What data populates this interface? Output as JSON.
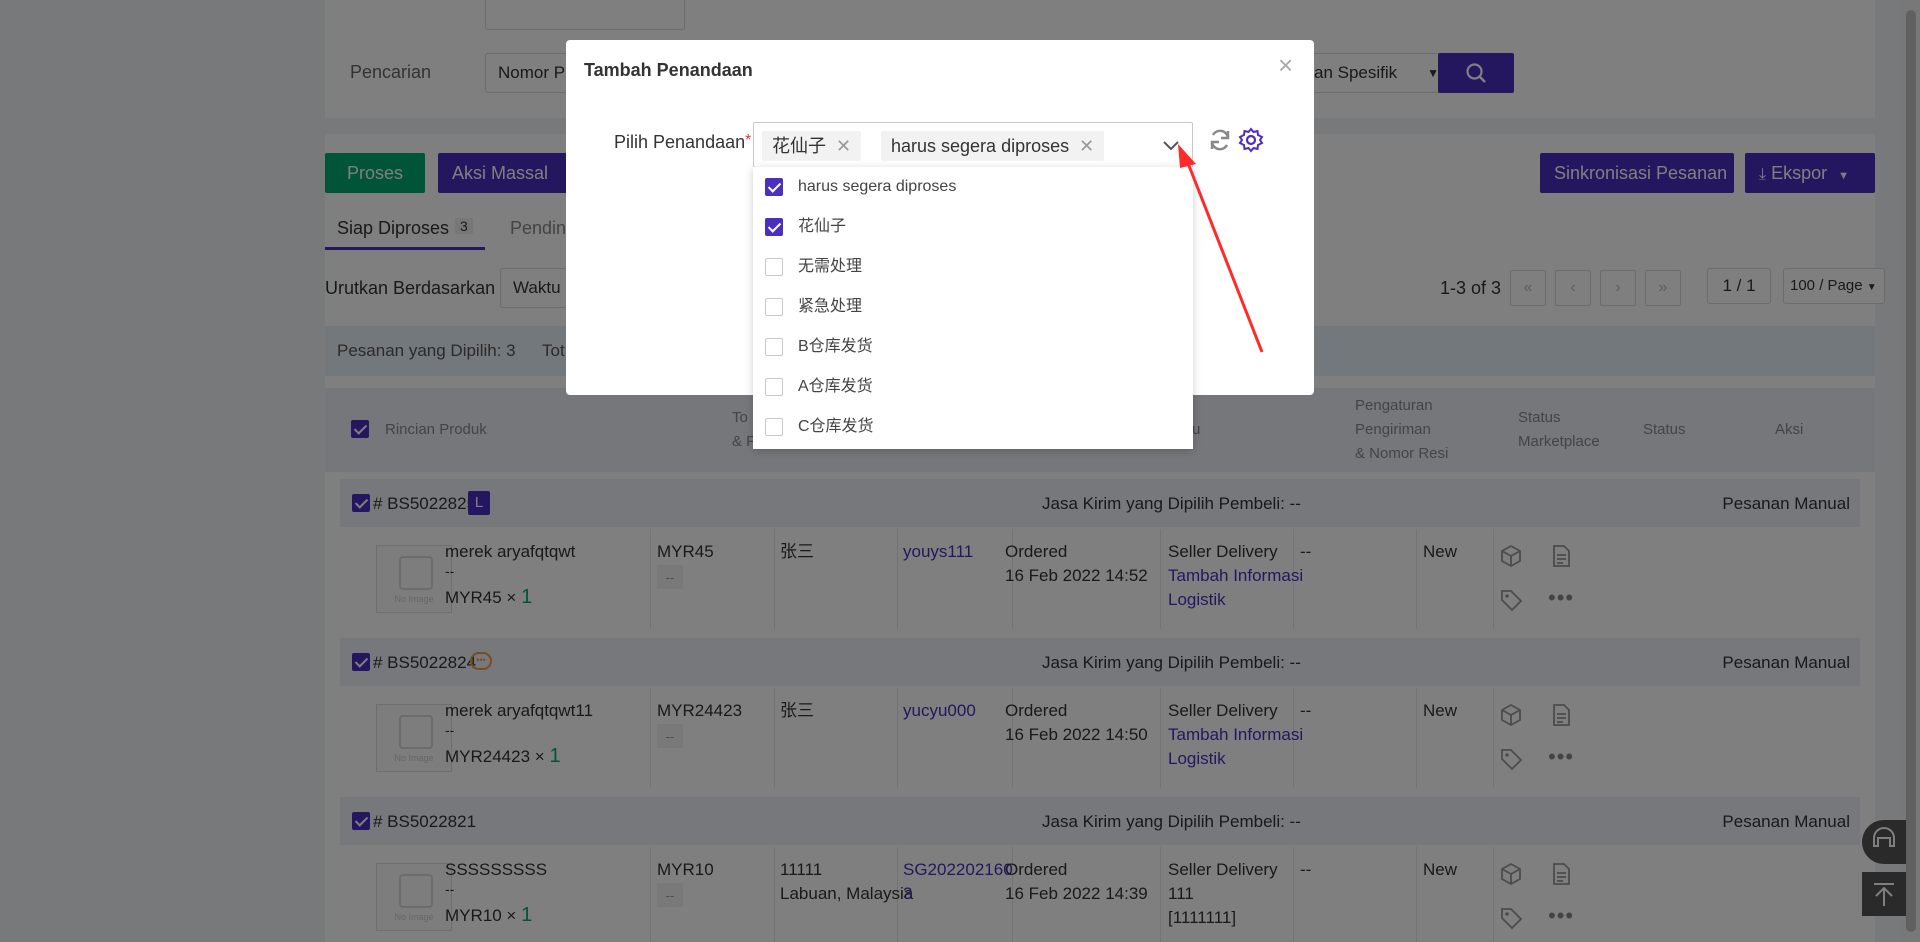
{
  "search": {
    "label": "Pencarian",
    "field_value": "Nomor P",
    "specific_value": "an Spesifik"
  },
  "actions": {
    "process": "Proses",
    "bulk": "Aksi Massal",
    "sync": "Sinkronisasi Pesanan",
    "export": "Ekspor"
  },
  "tabs": [
    {
      "label": "Siap Diproses",
      "count": "3"
    },
    {
      "label": "Pendin"
    }
  ],
  "sort": {
    "label": "Urutkan Berdasarkan",
    "value": "Waktu"
  },
  "pager": {
    "range": "1-3 of 3",
    "page": "1 / 1",
    "per_page": "100 / Page"
  },
  "selection": {
    "text": "Pesanan yang Dipilih: 3",
    "tot": "Tot"
  },
  "table": {
    "headers": {
      "product": "Rincian Produk",
      "total_l1": "To",
      "total_l2": "& F",
      "time": "u",
      "shipping": [
        "Pengaturan",
        "Pengiriman",
        "& Nomor Resi"
      ],
      "marketplace": [
        "Status",
        "Marketplace"
      ],
      "status": "Status",
      "actions": "Aksi"
    },
    "orders": [
      {
        "id": "# BS5022825",
        "badge": "L",
        "courier": "Jasa Kirim yang Dipilih Pembeli: --",
        "source": "Pesanan Manual",
        "product": "merek aryafqtqwt",
        "dash": "--",
        "price": "MYR45",
        "qty": "1",
        "total": "MYR45",
        "total_sub": "--",
        "buyer": "张三",
        "buyer_l2": "",
        "user": "youys111",
        "user_l2": "",
        "time_status": "Ordered",
        "time": "16 Feb 2022 14:52",
        "ship_l1": "Seller Delivery",
        "ship_l2": "Tambah Informasi",
        "ship_l3": "Logistik",
        "mkt": "--",
        "status": "New",
        "noimg": "No Image"
      },
      {
        "id": "# BS5022824",
        "badge": "",
        "courier": "Jasa Kirim yang Dipilih Pembeli: --",
        "source": "Pesanan Manual",
        "product": "merek aryafqtqwt11",
        "dash": "--",
        "price": "MYR24423",
        "qty": "1",
        "total": "MYR24423",
        "total_sub": "--",
        "buyer": "张三",
        "buyer_l2": "",
        "user": "yucyu000",
        "user_l2": "",
        "time_status": "Ordered",
        "time": "16 Feb 2022 14:50",
        "ship_l1": "Seller Delivery",
        "ship_l2": "Tambah Informasi",
        "ship_l3": "Logistik",
        "mkt": "--",
        "status": "New",
        "noimg": "No Image"
      },
      {
        "id": "# BS5022821",
        "badge": "",
        "courier": "Jasa Kirim yang Dipilih Pembeli: --",
        "source": "Pesanan Manual",
        "product": "SSSSSSSSS",
        "dash": "--",
        "price": "MYR10",
        "qty": "1",
        "total": "MYR10",
        "total_sub": "--",
        "buyer": "11111",
        "buyer_l2": "Labuan, Malaysia",
        "user": "SG202202160",
        "user_l2": "3",
        "time_status": "Ordered",
        "time": "16 Feb 2022 14:39",
        "ship_l1": "Seller Delivery",
        "ship_l2": "111",
        "ship_l3": "[1111111]",
        "mkt": "--",
        "status": "New",
        "noimg": "No Image"
      }
    ]
  },
  "modal": {
    "title": "Tambah Penandaan",
    "field_label": "Pilih Penandaan",
    "required_mark": "*",
    "selected_tags": [
      "花仙子",
      "harus segera diproses"
    ],
    "options": [
      {
        "label": "harus segera diproses",
        "checked": true
      },
      {
        "label": "花仙子",
        "checked": true
      },
      {
        "label": "无需处理",
        "checked": false
      },
      {
        "label": "紧急处理",
        "checked": false
      },
      {
        "label": "B仓库发货",
        "checked": false
      },
      {
        "label": "A仓库发货",
        "checked": false
      },
      {
        "label": "C仓库发货",
        "checked": false
      }
    ]
  },
  "colors": {
    "accent": "#4b2fbf",
    "green": "#00a870",
    "annotation_arrow": "#ff2a2a"
  },
  "icons": [
    "search-icon",
    "close-icon",
    "chevron-down-icon",
    "refresh-icon",
    "gear-icon",
    "package-icon",
    "document-icon",
    "tag-icon",
    "more-icon",
    "chat-icon",
    "back-to-top-icon"
  ]
}
